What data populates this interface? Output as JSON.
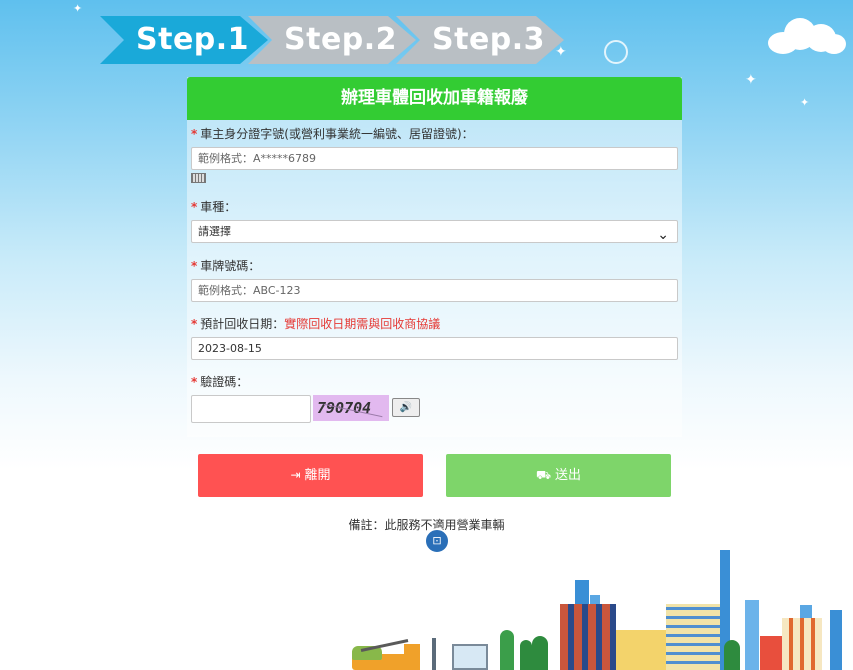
{
  "steps": [
    "Step.1",
    "Step.2",
    "Step.3"
  ],
  "form": {
    "title": "辦理車體回收加車籍報廢",
    "required_mark": "*",
    "id_label": "車主身分證字號(或營利事業統一編號、居留證號)：",
    "id_placeholder": "範例格式：A*****6789",
    "vehicle_type_label": "車種：",
    "vehicle_type_value": "請選擇",
    "plate_label": "車牌號碼：",
    "plate_placeholder": "範例格式：ABC-123",
    "date_label": "預計回收日期：",
    "date_note": "實際回收日期需與回收商協議",
    "date_value": "2023-08-15",
    "captcha_label": "驗證碼：",
    "captcha_text": "790704"
  },
  "buttons": {
    "leave_label": "離開",
    "send_label": "送出"
  },
  "remark": "備註：此服務不適用營業車輛",
  "icons": {
    "keyboard": "keyboard-icon",
    "chevron": "chevron-down-icon",
    "audio": "speaker-icon",
    "leave": "sign-out-icon",
    "send": "truck-icon"
  },
  "colors": {
    "header_green": "#33cc33",
    "step_active": "#1aa9d9",
    "step_inactive": "#b9bfc4",
    "leave_button": "#ff5252",
    "send_button": "#7ed56a",
    "required_red": "#e53935"
  }
}
